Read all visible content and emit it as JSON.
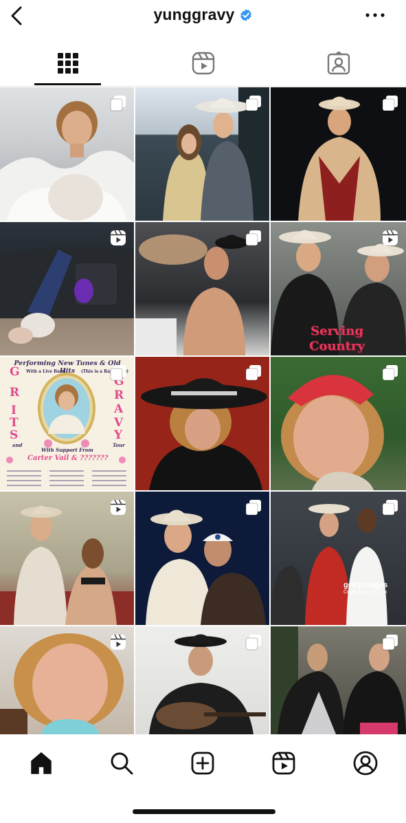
{
  "header": {
    "username": "yunggravy",
    "back_icon": "chevron-left-icon",
    "verified_icon": "verified-badge-icon",
    "more_icon": "more-horizontal-icon",
    "verified_color": "#3797f0"
  },
  "tabs": [
    {
      "name": "posts",
      "icon": "grid-icon",
      "selected": true
    },
    {
      "name": "reels",
      "icon": "reels-icon",
      "selected": false
    },
    {
      "name": "tagged",
      "icon": "tagged-icon",
      "selected": false
    }
  ],
  "grid": {
    "posts": [
      {
        "badge": "multiple-photos-icon"
      },
      {
        "badge": "multiple-photos-icon"
      },
      {
        "badge": "multiple-photos-icon"
      },
      {
        "badge": "reel-icon"
      },
      {
        "badge": "multiple-photos-icon"
      },
      {
        "badge": "reel-icon",
        "caption_line1": "Serving",
        "caption_line2": "Country"
      },
      {
        "badge": "multiple-photos-icon",
        "poster": {
          "headline": "Performing New Tunes & Old Hits",
          "subline_left": "With a Live Band",
          "subline_right": "(This is a Rap Show)",
          "word_left_letters": [
            "G",
            "R",
            "I",
            "T",
            "S"
          ],
          "word_right_letters": [
            "G",
            "R",
            "A",
            "V",
            "Y"
          ],
          "and_text": "and",
          "tour_text": "Tour",
          "support_label": "With Support From",
          "support_names": "Carter Vail & ???????"
        }
      },
      {
        "badge": "multiple-photos-icon"
      },
      {
        "badge": "multiple-photos-icon"
      },
      {
        "badge": "reel-icon"
      },
      {
        "badge": "multiple-photos-icon"
      },
      {
        "badge": "multiple-photos-icon",
        "watermark": "gettyimages",
        "credit": "Credit: Kevin C. Cox"
      },
      {
        "badge": "reel-icon"
      },
      {
        "badge": "multiple-photos-icon"
      },
      {
        "badge": "multiple-photos-icon"
      }
    ]
  },
  "bottom_nav": [
    {
      "name": "home",
      "icon": "home-icon",
      "active": true
    },
    {
      "name": "search",
      "icon": "search-icon",
      "active": false
    },
    {
      "name": "create",
      "icon": "create-post-icon",
      "active": false
    },
    {
      "name": "reels",
      "icon": "reels-icon",
      "active": false
    },
    {
      "name": "profile",
      "icon": "profile-icon",
      "active": false
    }
  ]
}
